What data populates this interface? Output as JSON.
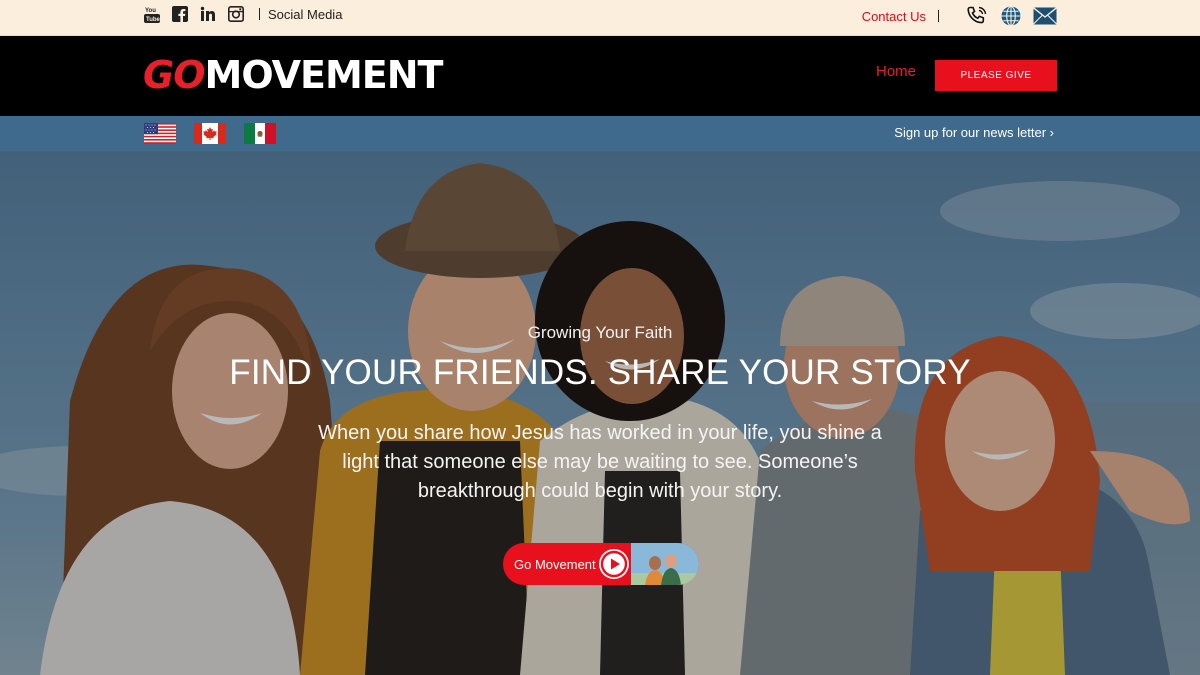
{
  "topbar": {
    "social_icons": [
      "youtube-icon",
      "facebook-icon",
      "linkedin-icon",
      "instagram-icon"
    ],
    "social_label": "Social Media",
    "contact_label": "Contact Us",
    "contact_icons": [
      "phone-icon",
      "globe-icon",
      "mail-icon"
    ]
  },
  "header": {
    "logo_go": "GO",
    "logo_movement": "MOVEMENT",
    "nav_home": "Home",
    "give_button": "PLEASE GIVE"
  },
  "langbar": {
    "flags": [
      "us-flag",
      "canada-flag",
      "mexico-flag"
    ],
    "newsletter_label": "Sign up for our news letter ›"
  },
  "hero": {
    "eyebrow": "Growing Your Faith",
    "headline": "FIND YOUR FRIENDS. SHARE YOUR STORY",
    "body": "When you share how Jesus has worked in your life, you shine a light that someone else may be waiting to see. Someone’s breakthrough could begin with your story.",
    "cta_label": "Go Movement",
    "image": "group-of-friends-photo"
  },
  "colors": {
    "brand_red": "#e8101c",
    "topbar_bg": "#fbeedc",
    "header_bg": "#000000",
    "langbar_bg": "#3f6a8b"
  }
}
